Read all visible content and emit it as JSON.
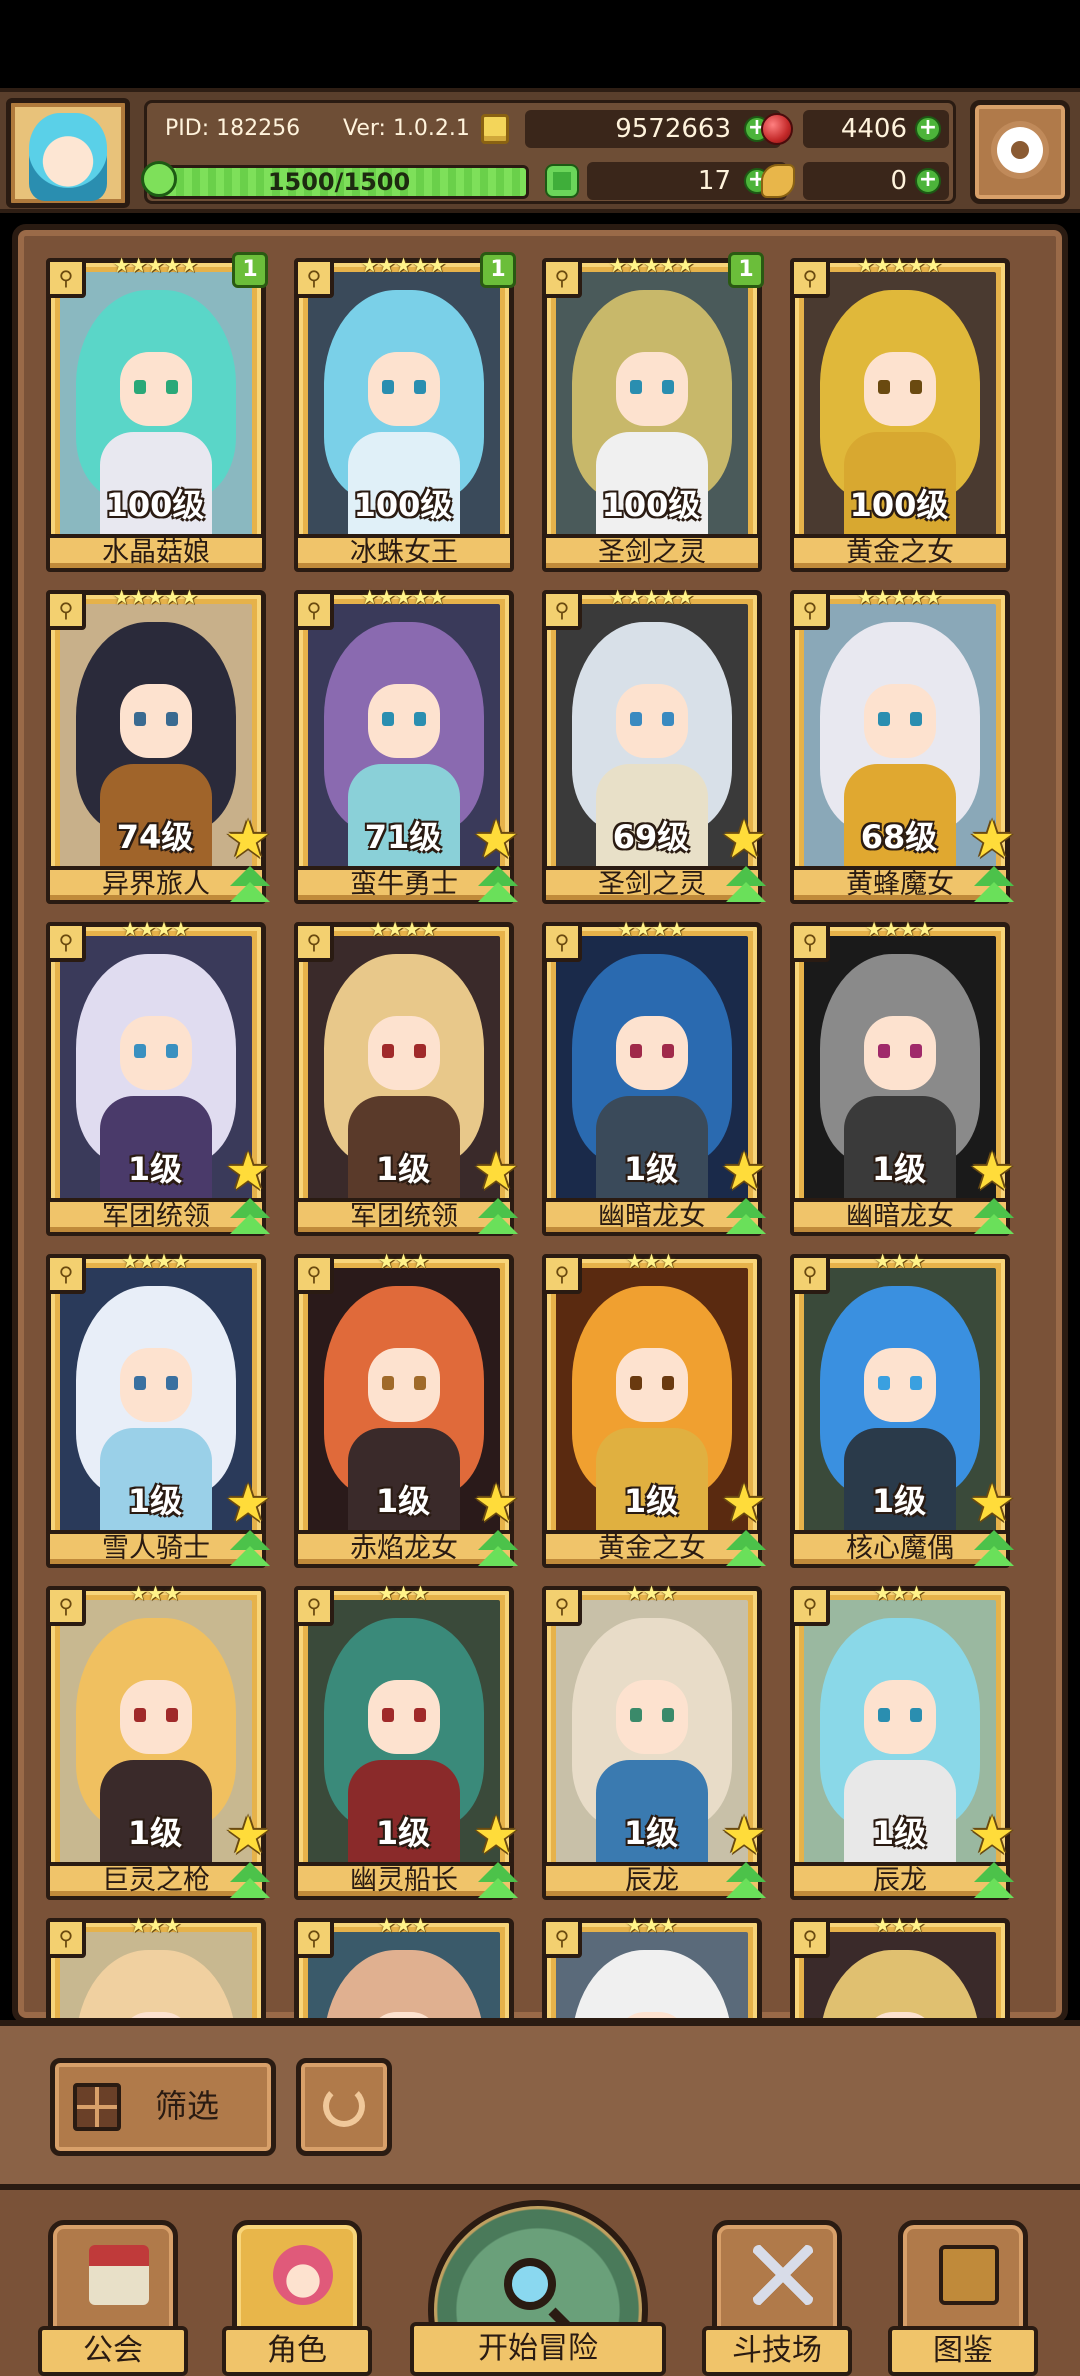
{
  "header": {
    "pid": "PID: 182256",
    "version": "Ver: 1.0.2.1",
    "gold": "9572663",
    "gems": "4406",
    "exp_text": "1500/1500",
    "exp_progress": 1.0,
    "clover": "17",
    "leaf": "0"
  },
  "cards": [
    {
      "stars": "★★★★★",
      "level": "100级",
      "name": "水晶菇娘",
      "badge": "1",
      "upgrade": false,
      "hair": "#5ad6c8",
      "body": "#e8e8f0",
      "eyes": "#2aa878",
      "bg": "#8ab8c0"
    },
    {
      "stars": "★★★★★",
      "level": "100级",
      "name": "冰蛛女王",
      "badge": "1",
      "upgrade": false,
      "hair": "#7ad0e8",
      "body": "#e0f0f8",
      "eyes": "#2a8eb0",
      "bg": "#3a4a5a"
    },
    {
      "stars": "★★★★★",
      "level": "100级",
      "name": "圣剑之灵",
      "badge": "1",
      "upgrade": false,
      "hair": "#c8b86a",
      "body": "#f0f0f0",
      "eyes": "#2a8eb0",
      "bg": "#4a5a5a"
    },
    {
      "stars": "★★★★★",
      "level": "100级",
      "name": "黄金之女",
      "badge": "",
      "upgrade": false,
      "hair": "#e0b83a",
      "body": "#d8a830",
      "eyes": "#6a4a10",
      "bg": "#4a3a30"
    },
    {
      "stars": "★★★★★",
      "level": "74级",
      "name": "异界旅人",
      "badge": "",
      "upgrade": true,
      "hair": "#2a2a3a",
      "body": "#a0642a",
      "eyes": "#3a6a90",
      "bg": "#c8b08a"
    },
    {
      "stars": "★★★★★",
      "level": "71级",
      "name": "蛮牛勇士",
      "badge": "",
      "upgrade": true,
      "hair": "#8a6ab0",
      "body": "#8ad0d8",
      "eyes": "#2a8eb0",
      "bg": "#3a3a5a"
    },
    {
      "stars": "★★★★★",
      "level": "69级",
      "name": "圣剑之灵",
      "badge": "",
      "upgrade": true,
      "hair": "#d8e0e8",
      "body": "#e8e0c8",
      "eyes": "#3a8ac0",
      "bg": "#3a3a3a"
    },
    {
      "stars": "★★★★★",
      "level": "68级",
      "name": "黄蜂魔女",
      "badge": "",
      "upgrade": true,
      "hair": "#e8e8f0",
      "body": "#e0a830",
      "eyes": "#2a8eb0",
      "bg": "#8aa8b8"
    },
    {
      "stars": "★★★★",
      "level": "1级",
      "name": "军团统领",
      "badge": "",
      "upgrade": true,
      "hair": "#e0dcf0",
      "body": "#4a3a6a",
      "eyes": "#3a90c0",
      "bg": "#3a3a5a"
    },
    {
      "stars": "★★★★",
      "level": "1级",
      "name": "军团统领",
      "badge": "",
      "upgrade": true,
      "hair": "#e8c88a",
      "body": "#5a3a2a",
      "eyes": "#a02a2a",
      "bg": "#3a2a2a"
    },
    {
      "stars": "★★★★",
      "level": "1级",
      "name": "幽暗龙女",
      "badge": "",
      "upgrade": true,
      "hair": "#2a6ab0",
      "body": "#3a4a5a",
      "eyes": "#a02a4a",
      "bg": "#1a2a4a"
    },
    {
      "stars": "★★★★",
      "level": "1级",
      "name": "幽暗龙女",
      "badge": "",
      "upgrade": true,
      "hair": "#8a8a8a",
      "body": "#3a3a3a",
      "eyes": "#a02a6a",
      "bg": "#1a1a1a"
    },
    {
      "stars": "★★★★",
      "level": "1级",
      "name": "雪人骑士",
      "badge": "",
      "upgrade": true,
      "hair": "#e8eef8",
      "body": "#9ad0e8",
      "eyes": "#3a70a0",
      "bg": "#2a3a5a"
    },
    {
      "stars": "★★★",
      "level": "1级",
      "name": "赤焰龙女",
      "badge": "",
      "upgrade": true,
      "hair": "#e06a3a",
      "body": "#3a2a2a",
      "eyes": "#a06a2a",
      "bg": "#2a1a1a"
    },
    {
      "stars": "★★★",
      "level": "1级",
      "name": "黄金之女",
      "badge": "",
      "upgrade": true,
      "hair": "#f0a030",
      "body": "#e0b040",
      "eyes": "#6a3a10",
      "bg": "#5a2a10"
    },
    {
      "stars": "★★★",
      "level": "1级",
      "name": "核心魔偶",
      "badge": "",
      "upgrade": true,
      "hair": "#3a90e0",
      "body": "#2a3a4a",
      "eyes": "#3aa0e0",
      "bg": "#3a4a3a"
    },
    {
      "stars": "★★★",
      "level": "1级",
      "name": "巨灵之枪",
      "badge": "",
      "upgrade": true,
      "hair": "#f0c060",
      "body": "#3a2a2a",
      "eyes": "#a02a2a",
      "bg": "#c8b890"
    },
    {
      "stars": "★★★",
      "level": "1级",
      "name": "幽灵船长",
      "badge": "",
      "upgrade": true,
      "hair": "#3a8a7a",
      "body": "#8a2a2a",
      "eyes": "#a02a2a",
      "bg": "#3a4a3a"
    },
    {
      "stars": "★★★",
      "level": "1级",
      "name": "辰龙",
      "badge": "",
      "upgrade": true,
      "hair": "#e8dcc8",
      "body": "#3a7ab0",
      "eyes": "#3a8a6a",
      "bg": "#c8c0a8"
    },
    {
      "stars": "★★★",
      "level": "1级",
      "name": "辰龙",
      "badge": "",
      "upgrade": true,
      "hair": "#8ad8e8",
      "body": "#e8e8e8",
      "eyes": "#2a8eb0",
      "bg": "#9ab8a0"
    },
    {
      "stars": "★★★",
      "level": "",
      "name": "",
      "badge": "",
      "upgrade": false,
      "hair": "#f0d0a0",
      "body": "#e8e0d8",
      "eyes": "#a03a2a",
      "bg": "#c8b890"
    },
    {
      "stars": "★★★",
      "level": "",
      "name": "",
      "badge": "",
      "upgrade": false,
      "hair": "#e0b090",
      "body": "#e8a0a0",
      "eyes": "#6a3a2a",
      "bg": "#3a5a6a"
    },
    {
      "stars": "★★★",
      "level": "",
      "name": "",
      "badge": "",
      "upgrade": false,
      "hair": "#f0f0f0",
      "body": "#d8d8d8",
      "eyes": "#a02a2a",
      "bg": "#5a6a7a"
    },
    {
      "stars": "★★★",
      "level": "",
      "name": "",
      "badge": "",
      "upgrade": false,
      "hair": "#e0c070",
      "body": "#c02a3a",
      "eyes": "#6a3a10",
      "bg": "#3a2a2a"
    }
  ],
  "filter": {
    "label": "筛选"
  },
  "nav": {
    "guild": "公会",
    "character": "角色",
    "adventure": "开始冒险",
    "arena": "斗技场",
    "codex": "图鉴"
  }
}
